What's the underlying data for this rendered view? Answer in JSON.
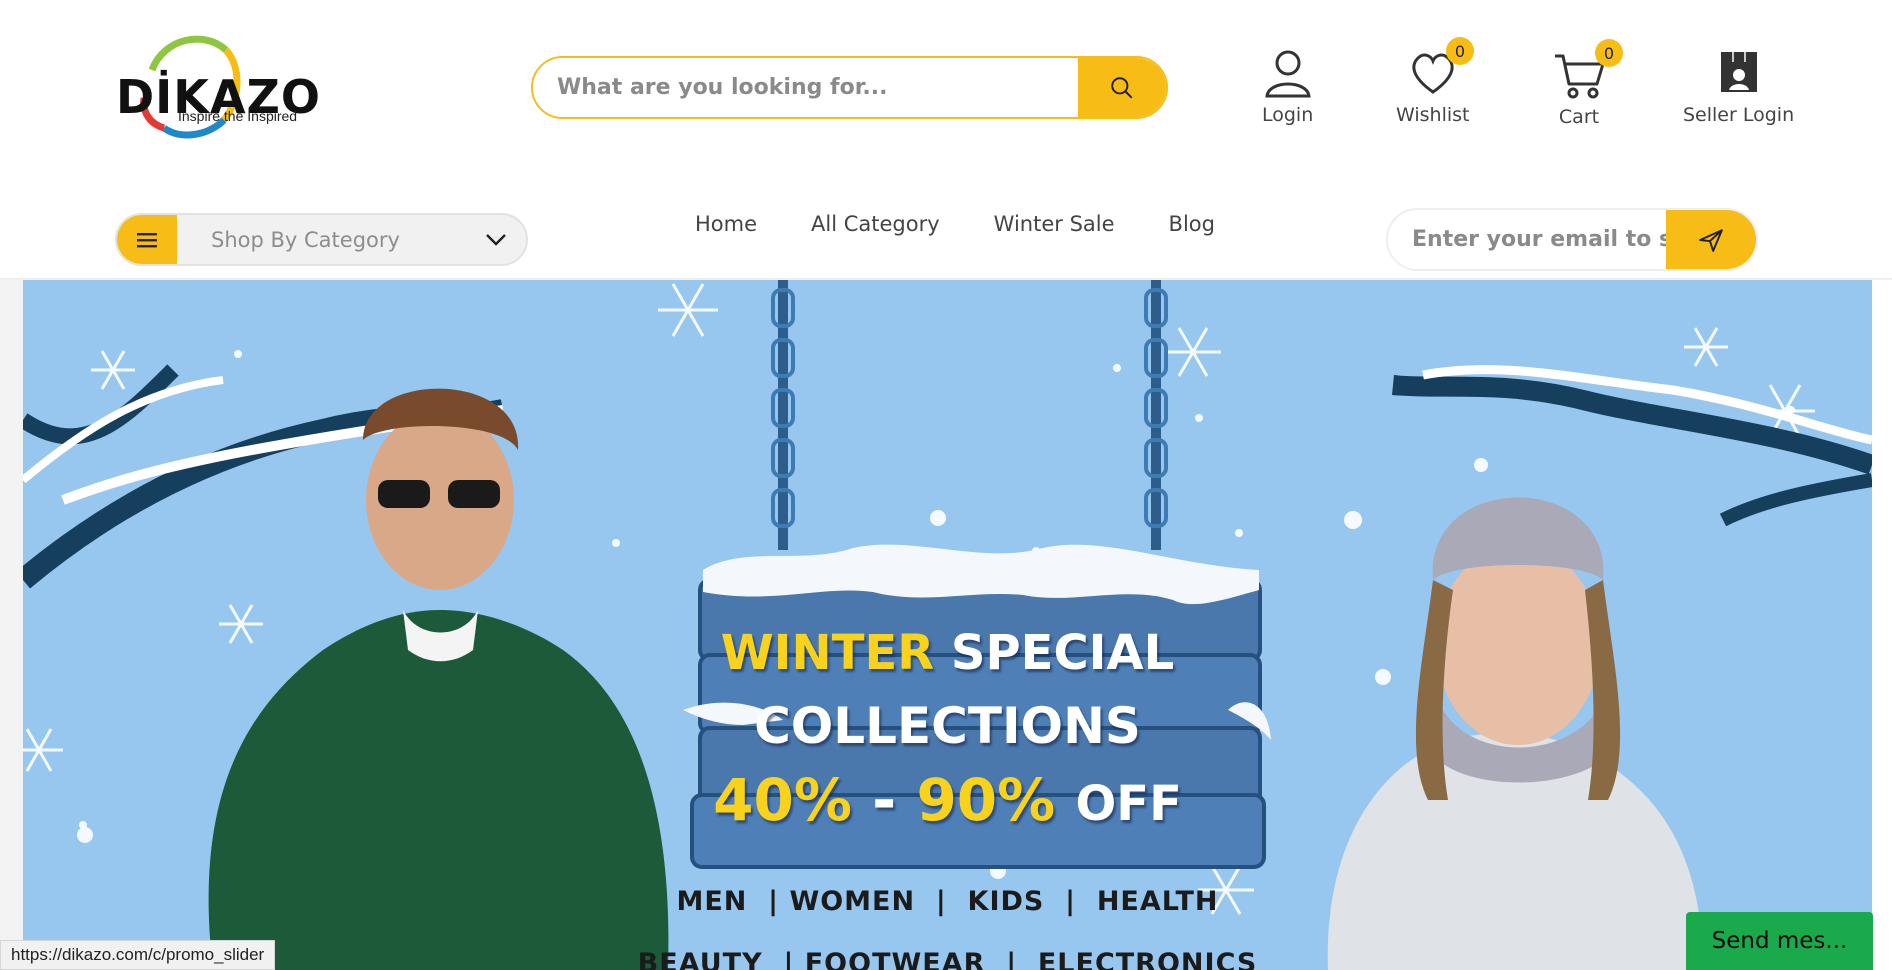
{
  "header": {
    "logo": {
      "name": "DİKAZO",
      "tagline": "Inspire the Inspired"
    },
    "search": {
      "placeholder": "What are you looking for..."
    },
    "login_label": "Login",
    "wishlist_label": "Wishlist",
    "wishlist_count": "0",
    "cart_label": "Cart",
    "cart_count": "0",
    "seller_label": "Seller Login"
  },
  "navbar": {
    "category_select": "Shop By Category",
    "links": [
      "Home",
      "All Category",
      "Winter Sale",
      "Blog"
    ],
    "newsletter_placeholder": "Enter your email to subscribe"
  },
  "banner": {
    "headline_word1": "WINTER",
    "headline_word2": "SPECIAL",
    "headline_line2": "COLLECTIONS",
    "discount_range_a": "40%",
    "discount_dash": "-",
    "discount_range_b": "90%",
    "discount_suffix": "OFF",
    "categories_line1": "MEN  | WOMEN  |  KIDS  |  HEALTH",
    "categories_line2": "BEAUTY  | FOOTWEAR  |  ELECTRONICS"
  },
  "status_bar": {
    "url": "https://dikazo.com/c/promo_slider"
  },
  "chat": {
    "label": "Send mes..."
  },
  "colors": {
    "accent": "#f8bc16",
    "banner_bg": "#97c7ef",
    "chat_green": "#1aaa4b"
  }
}
